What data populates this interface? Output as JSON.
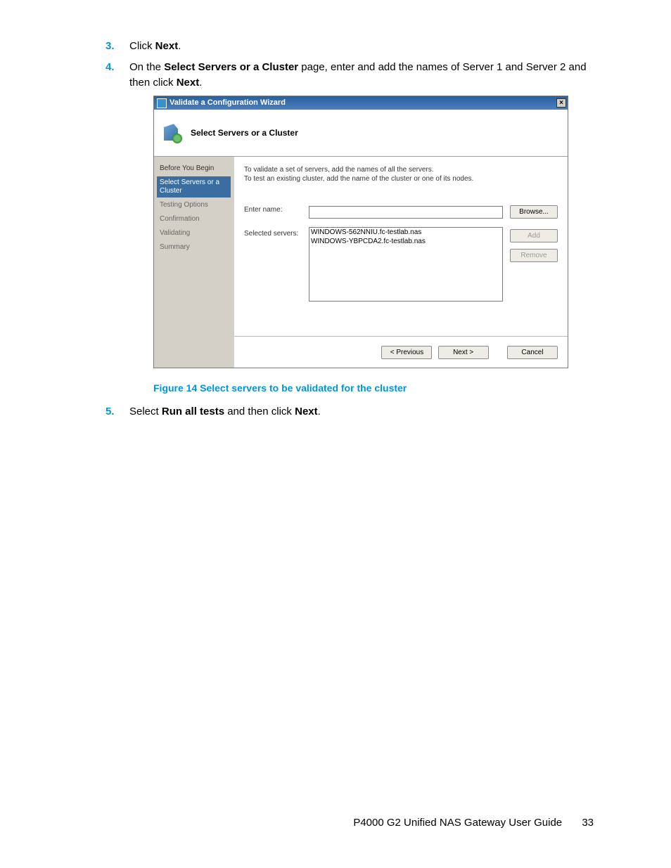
{
  "steps": {
    "s3": {
      "num": "3.",
      "pre": "Click ",
      "bold": "Next",
      "post": "."
    },
    "s4": {
      "num": "4.",
      "pre": "On the ",
      "bold": "Select Servers or a Cluster",
      "mid": " page, enter and add the names of Server 1 and Server 2 and then click ",
      "bold2": "Next",
      "post": "."
    },
    "s5": {
      "num": "5.",
      "pre": "Select ",
      "bold": "Run all tests",
      "mid": " and then click ",
      "bold2": "Next",
      "post": "."
    }
  },
  "figure_caption": "Figure 14 Select servers to be validated for the cluster",
  "wizard": {
    "title": "Validate a Configuration Wizard",
    "header_title": "Select Servers or a Cluster",
    "nav": {
      "before": "Before You Begin",
      "select": "Select Servers or a Cluster",
      "testing": "Testing Options",
      "confirm": "Confirmation",
      "validating": "Validating",
      "summary": "Summary"
    },
    "instructions_line1": "To validate a set of servers, add the names of all the servers.",
    "instructions_line2": "To test an existing cluster, add the name of the cluster or one of its nodes.",
    "labels": {
      "enter_name": "Enter name:",
      "selected_servers": "Selected servers:"
    },
    "server_list": {
      "row1": "WINDOWS-562NNIU.fc-testlab.nas",
      "row2": "WINDOWS-YBPCDA2.fc-testlab.nas"
    },
    "buttons": {
      "browse": "Browse...",
      "add": "Add",
      "remove": "Remove",
      "previous": "< Previous",
      "next": "Next >",
      "cancel": "Cancel"
    }
  },
  "footer": {
    "doc_title": "P4000 G2 Unified NAS Gateway User Guide",
    "page_number": "33"
  }
}
